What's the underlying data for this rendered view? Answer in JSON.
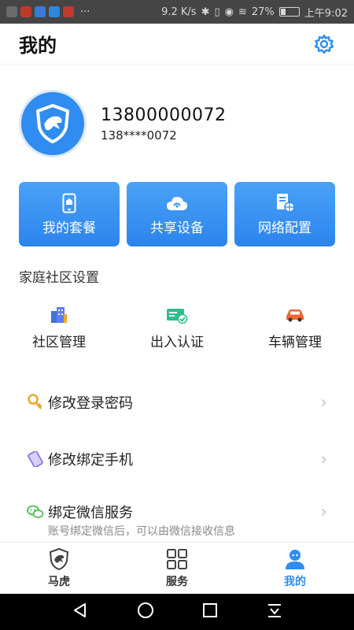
{
  "status_bar": {
    "speed": "9.2 K/s",
    "battery": "27%",
    "battery_level": 0.27,
    "time": "上午9:02",
    "dots": "···"
  },
  "header": {
    "title": "我的"
  },
  "profile": {
    "phone": "13800000072",
    "masked_phone": "138****0072"
  },
  "tiles": [
    {
      "label": "我的套餐",
      "icon": "phone-package-icon"
    },
    {
      "label": "共享设备",
      "icon": "cloud-share-icon"
    },
    {
      "label": "网络配置",
      "icon": "network-config-icon"
    }
  ],
  "community": {
    "title": "家庭社区设置",
    "items": [
      {
        "label": "社区管理",
        "icon": "building-icon"
      },
      {
        "label": "出入认证",
        "icon": "card-check-icon"
      },
      {
        "label": "车辆管理",
        "icon": "car-icon"
      }
    ]
  },
  "menu": [
    {
      "label": "修改登录密码",
      "icon": "key-icon"
    },
    {
      "label": "修改绑定手机",
      "icon": "phone-icon"
    },
    {
      "label": "绑定微信服务",
      "icon": "wechat-icon",
      "sub": "账号绑定微信后，可以由微信接收信息"
    }
  ],
  "tabbar": [
    {
      "label": "马虎",
      "icon": "shield-logo-icon",
      "active": false
    },
    {
      "label": "服务",
      "icon": "grid-icon",
      "active": false
    },
    {
      "label": "我的",
      "icon": "user-icon",
      "active": true
    }
  ],
  "colors": {
    "accent": "#2f8cf0",
    "status_bar": "#454545",
    "nav_bar": "#000000"
  }
}
